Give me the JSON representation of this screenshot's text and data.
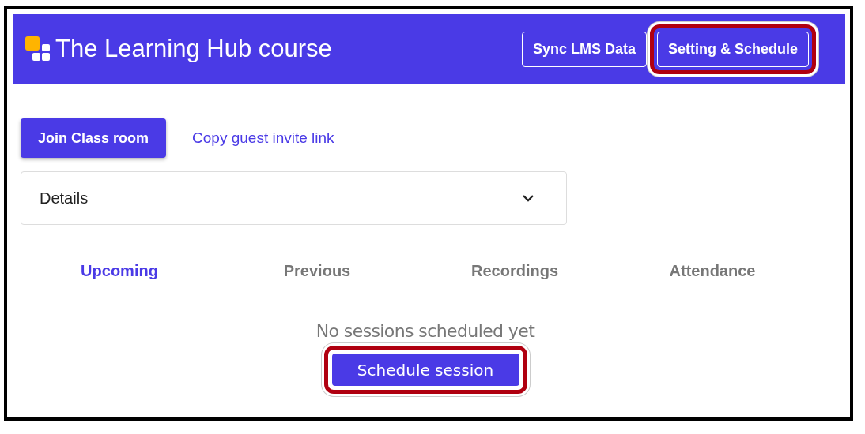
{
  "header": {
    "title": "The Learning Hub course",
    "buttons": [
      {
        "label": "Sync LMS Data",
        "highlighted": false
      },
      {
        "label": "Setting & Schedule",
        "highlighted": true
      }
    ]
  },
  "actions": {
    "join_button": "Join Class room",
    "invite_link": "Copy guest invite link"
  },
  "details": {
    "label": "Details",
    "expanded": false
  },
  "tabs": [
    {
      "label": "Upcoming",
      "selected": true
    },
    {
      "label": "Previous",
      "selected": false
    },
    {
      "label": "Recordings",
      "selected": false
    },
    {
      "label": "Attendance",
      "selected": false
    }
  ],
  "empty_state": {
    "message": "No sessions scheduled yet",
    "button": {
      "label": "Schedule session",
      "highlighted": true
    }
  }
}
